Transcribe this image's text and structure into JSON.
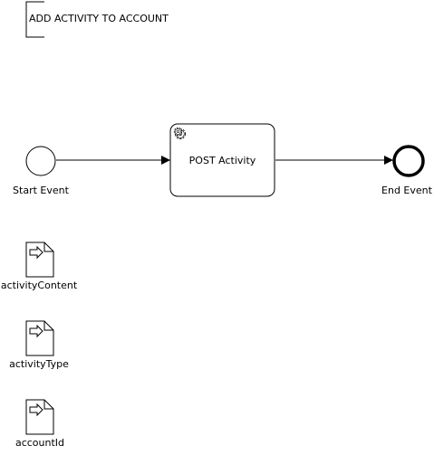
{
  "annotation": {
    "text": "ADD ACTIVITY TO ACCOUNT"
  },
  "start_event": {
    "label": "Start Event"
  },
  "task": {
    "label": "POST Activity",
    "icon": "gear-icon"
  },
  "end_event": {
    "label": "End Event"
  },
  "data_inputs": [
    {
      "label": "activityContent",
      "icon": "data-input-icon"
    },
    {
      "label": "activityType",
      "icon": "data-input-icon"
    },
    {
      "label": "accountId",
      "icon": "data-input-icon"
    }
  ],
  "colors": {
    "stroke": "#000000",
    "fill": "#ffffff"
  }
}
